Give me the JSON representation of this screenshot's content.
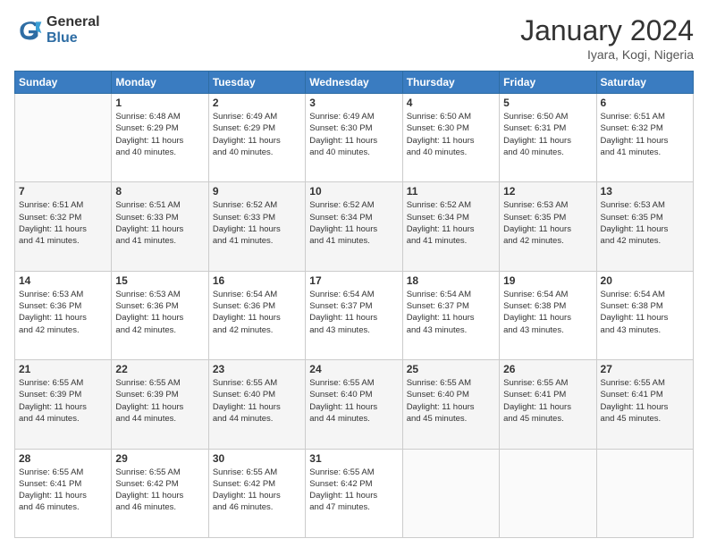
{
  "logo": {
    "general": "General",
    "blue": "Blue"
  },
  "title": {
    "month_year": "January 2024",
    "location": "Iyara, Kogi, Nigeria"
  },
  "weekdays": [
    "Sunday",
    "Monday",
    "Tuesday",
    "Wednesday",
    "Thursday",
    "Friday",
    "Saturday"
  ],
  "weeks": [
    [
      {
        "day": null
      },
      {
        "day": 1,
        "sunrise": "6:48 AM",
        "sunset": "6:29 PM",
        "daylight": "11 hours and 40 minutes."
      },
      {
        "day": 2,
        "sunrise": "6:49 AM",
        "sunset": "6:29 PM",
        "daylight": "11 hours and 40 minutes."
      },
      {
        "day": 3,
        "sunrise": "6:49 AM",
        "sunset": "6:30 PM",
        "daylight": "11 hours and 40 minutes."
      },
      {
        "day": 4,
        "sunrise": "6:50 AM",
        "sunset": "6:30 PM",
        "daylight": "11 hours and 40 minutes."
      },
      {
        "day": 5,
        "sunrise": "6:50 AM",
        "sunset": "6:31 PM",
        "daylight": "11 hours and 40 minutes."
      },
      {
        "day": 6,
        "sunrise": "6:51 AM",
        "sunset": "6:32 PM",
        "daylight": "11 hours and 41 minutes."
      }
    ],
    [
      {
        "day": 7,
        "sunrise": "6:51 AM",
        "sunset": "6:32 PM",
        "daylight": "11 hours and 41 minutes."
      },
      {
        "day": 8,
        "sunrise": "6:51 AM",
        "sunset": "6:33 PM",
        "daylight": "11 hours and 41 minutes."
      },
      {
        "day": 9,
        "sunrise": "6:52 AM",
        "sunset": "6:33 PM",
        "daylight": "11 hours and 41 minutes."
      },
      {
        "day": 10,
        "sunrise": "6:52 AM",
        "sunset": "6:34 PM",
        "daylight": "11 hours and 41 minutes."
      },
      {
        "day": 11,
        "sunrise": "6:52 AM",
        "sunset": "6:34 PM",
        "daylight": "11 hours and 41 minutes."
      },
      {
        "day": 12,
        "sunrise": "6:53 AM",
        "sunset": "6:35 PM",
        "daylight": "11 hours and 42 minutes."
      },
      {
        "day": 13,
        "sunrise": "6:53 AM",
        "sunset": "6:35 PM",
        "daylight": "11 hours and 42 minutes."
      }
    ],
    [
      {
        "day": 14,
        "sunrise": "6:53 AM",
        "sunset": "6:36 PM",
        "daylight": "11 hours and 42 minutes."
      },
      {
        "day": 15,
        "sunrise": "6:53 AM",
        "sunset": "6:36 PM",
        "daylight": "11 hours and 42 minutes."
      },
      {
        "day": 16,
        "sunrise": "6:54 AM",
        "sunset": "6:36 PM",
        "daylight": "11 hours and 42 minutes."
      },
      {
        "day": 17,
        "sunrise": "6:54 AM",
        "sunset": "6:37 PM",
        "daylight": "11 hours and 43 minutes."
      },
      {
        "day": 18,
        "sunrise": "6:54 AM",
        "sunset": "6:37 PM",
        "daylight": "11 hours and 43 minutes."
      },
      {
        "day": 19,
        "sunrise": "6:54 AM",
        "sunset": "6:38 PM",
        "daylight": "11 hours and 43 minutes."
      },
      {
        "day": 20,
        "sunrise": "6:54 AM",
        "sunset": "6:38 PM",
        "daylight": "11 hours and 43 minutes."
      }
    ],
    [
      {
        "day": 21,
        "sunrise": "6:55 AM",
        "sunset": "6:39 PM",
        "daylight": "11 hours and 44 minutes."
      },
      {
        "day": 22,
        "sunrise": "6:55 AM",
        "sunset": "6:39 PM",
        "daylight": "11 hours and 44 minutes."
      },
      {
        "day": 23,
        "sunrise": "6:55 AM",
        "sunset": "6:40 PM",
        "daylight": "11 hours and 44 minutes."
      },
      {
        "day": 24,
        "sunrise": "6:55 AM",
        "sunset": "6:40 PM",
        "daylight": "11 hours and 44 minutes."
      },
      {
        "day": 25,
        "sunrise": "6:55 AM",
        "sunset": "6:40 PM",
        "daylight": "11 hours and 45 minutes."
      },
      {
        "day": 26,
        "sunrise": "6:55 AM",
        "sunset": "6:41 PM",
        "daylight": "11 hours and 45 minutes."
      },
      {
        "day": 27,
        "sunrise": "6:55 AM",
        "sunset": "6:41 PM",
        "daylight": "11 hours and 45 minutes."
      }
    ],
    [
      {
        "day": 28,
        "sunrise": "6:55 AM",
        "sunset": "6:41 PM",
        "daylight": "11 hours and 46 minutes."
      },
      {
        "day": 29,
        "sunrise": "6:55 AM",
        "sunset": "6:42 PM",
        "daylight": "11 hours and 46 minutes."
      },
      {
        "day": 30,
        "sunrise": "6:55 AM",
        "sunset": "6:42 PM",
        "daylight": "11 hours and 46 minutes."
      },
      {
        "day": 31,
        "sunrise": "6:55 AM",
        "sunset": "6:42 PM",
        "daylight": "11 hours and 47 minutes."
      },
      {
        "day": null
      },
      {
        "day": null
      },
      {
        "day": null
      }
    ]
  ],
  "labels": {
    "sunrise_prefix": "Sunrise:",
    "sunset_prefix": "Sunset:",
    "daylight_prefix": "Daylight:"
  }
}
